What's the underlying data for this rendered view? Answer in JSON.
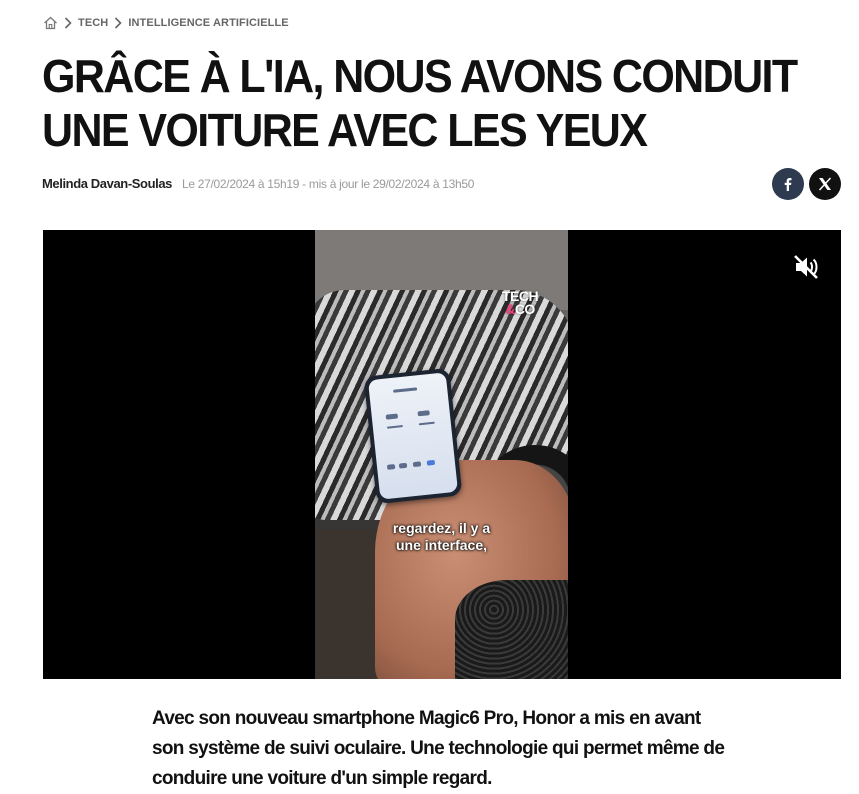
{
  "breadcrumb": {
    "home_icon": "home-icon",
    "separator_icon": "chevron-right-icon",
    "items": [
      "TECH",
      "INTELLIGENCE ARTIFICIELLE"
    ]
  },
  "article": {
    "title": "GRÂCE À L'IA, NOUS AVONS CONDUIT UNE VOITURE AVEC LES YEUX",
    "author": "Melinda Davan-Soulas",
    "dates": "Le 27/02/2024 à 15h19 - mis à jour le 29/02/2024 à 13h50",
    "lede": "Avec son nouveau smartphone Magic6 Pro, Honor a mis en avant son système de suivi oculaire. Une technologie qui permet même de conduire une voiture d'un simple regard."
  },
  "share": {
    "facebook_icon": "facebook-icon",
    "x_icon": "x-icon",
    "colors": {
      "facebook": "#2d3a50",
      "x": "#111111"
    }
  },
  "video": {
    "brand_line1": "TECH",
    "brand_amp": "&",
    "brand_line2": "CO",
    "subtitle_line1": "regardez, il y a",
    "subtitle_line2": "une interface,",
    "mute_icon": "muted-speaker-icon",
    "muted": true
  }
}
